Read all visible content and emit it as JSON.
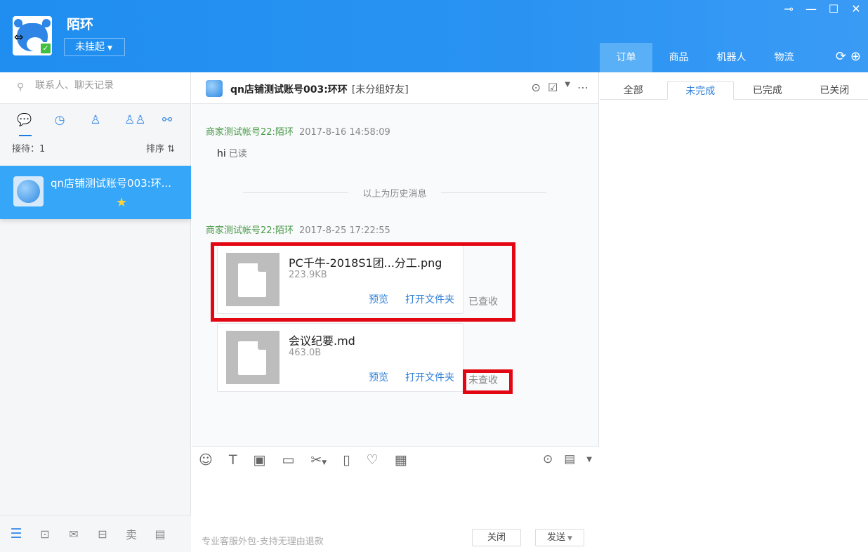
{
  "header": {
    "username": "陌环",
    "status": "未挂起",
    "right_tabs": [
      {
        "label": "订单",
        "active": true
      },
      {
        "label": "商品",
        "active": false
      },
      {
        "label": "机器人",
        "active": false
      },
      {
        "label": "物流",
        "active": false
      }
    ],
    "window_controls": [
      "pin-icon",
      "minimize-icon",
      "maximize-icon",
      "close-icon"
    ],
    "header_icons": [
      "refresh-icon",
      "add-icon"
    ]
  },
  "sidebar": {
    "search_placeholder": "联系人、聊天记录",
    "nav_icons": [
      "chat-icon",
      "history-icon",
      "contact-icon",
      "group-icon",
      "org-icon"
    ],
    "reception_label": "接待：1",
    "sort_label": "排序 ⇅",
    "conversations": [
      {
        "name": "qn店铺测试账号003:环...",
        "starred": true
      }
    ],
    "bottom_icons": [
      "menu-icon",
      "shop-icon",
      "mail-icon",
      "store-icon",
      "sell-icon",
      "layout-icon"
    ],
    "sell_label": "卖"
  },
  "chat": {
    "title": "qn店铺测试账号003:环环",
    "subtitle": "[未分组好友]",
    "messages": [
      {
        "sender": "商家测试帐号22:陌环",
        "time": "2017-8-16 14:58:09",
        "text": "hi",
        "read": "已读"
      }
    ],
    "history_separator": "以上为历史消息",
    "file_group": {
      "sender": "商家测试帐号22:陌环",
      "time": "2017-8-25 17:22:55",
      "files": [
        {
          "name": "PC千牛-2018S1团...分工.png",
          "size": "223.9KB",
          "preview": "预览",
          "open_folder": "打开文件夹",
          "status": "已查收"
        },
        {
          "name": "会议纪要.md",
          "size": "463.0B",
          "preview": "预览",
          "open_folder": "打开文件夹",
          "status": "未查收"
        }
      ]
    },
    "footer_tip": "专业客服外包-支持无理由退款",
    "close_label": "关闭",
    "send_label": "发送"
  },
  "orders": {
    "tabs": [
      {
        "label": "全部",
        "active": false
      },
      {
        "label": "未完成",
        "active": true
      },
      {
        "label": "已完成",
        "active": false
      },
      {
        "label": "已关闭",
        "active": false
      }
    ]
  },
  "colors": {
    "header_blue": "#1f8ef0",
    "selected_conversation": "#35a6f8",
    "link_blue": "#2f7fd8",
    "sender_green": "#4a9a4a",
    "highlight_red": "#e30613"
  }
}
